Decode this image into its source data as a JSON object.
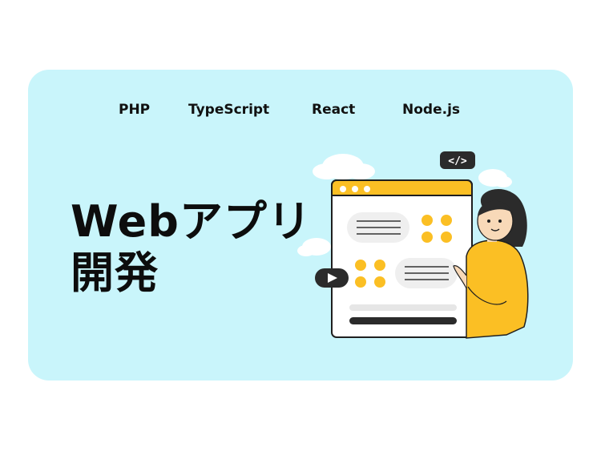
{
  "tech_tags": [
    "PHP",
    "TypeScript",
    "React",
    "Node.js"
  ],
  "headline": {
    "line1": "Webアプリ",
    "line2": "開発"
  },
  "code_badge": "</>",
  "colors": {
    "card_bg": "#c9f5fb",
    "accent": "#fbbf24",
    "text": "#0d0d0d",
    "window_bar": "#fbbf24"
  },
  "icons": [
    "code-icon",
    "play-icon",
    "cloud-icon"
  ]
}
